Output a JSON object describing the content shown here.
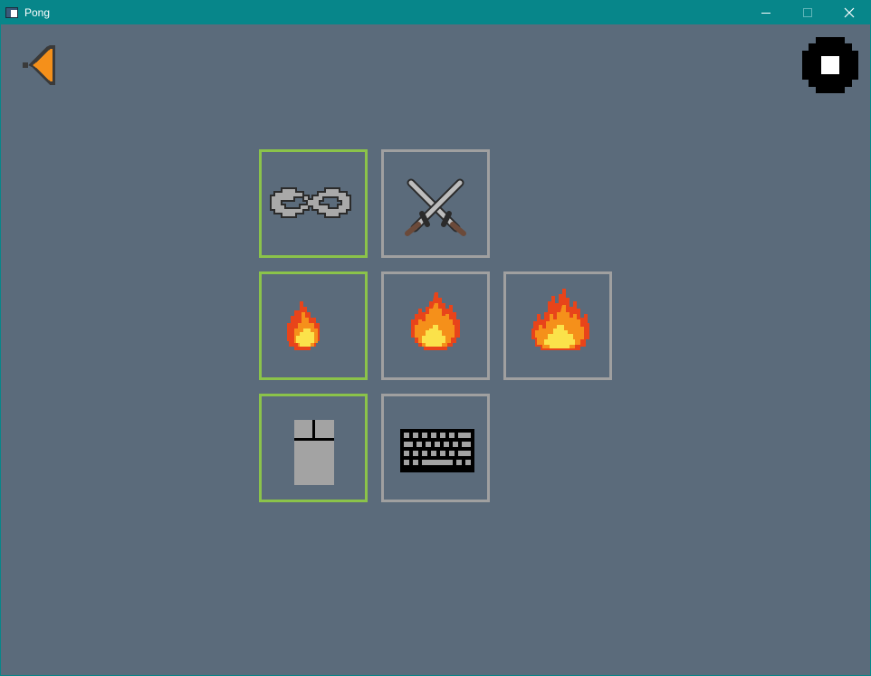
{
  "window": {
    "title": "Pong",
    "app_icon": "window-app-icon",
    "controls": [
      "minimize-icon",
      "maximize-icon",
      "close-icon"
    ]
  },
  "colors": {
    "titlebar": "#07868a",
    "background": "#5b6b7b",
    "tile_selected_border": "#8bc34a",
    "tile_default_border": "#a0a0a0",
    "back_arrow": "#f5901a"
  },
  "toolbar": {
    "back_icon": "back-arrow-icon",
    "stop_icon": "stop-icon"
  },
  "options": {
    "mode": [
      {
        "icon": "infinity-icon",
        "selected": true
      },
      {
        "icon": "crossed-swords-icon",
        "selected": false
      }
    ],
    "speed": [
      {
        "icon": "small-flame-icon",
        "selected": true
      },
      {
        "icon": "medium-flame-icon",
        "selected": false
      },
      {
        "icon": "large-flame-icon",
        "selected": false
      }
    ],
    "control": [
      {
        "icon": "mouse-icon",
        "selected": true
      },
      {
        "icon": "keyboard-icon",
        "selected": false
      }
    ]
  }
}
